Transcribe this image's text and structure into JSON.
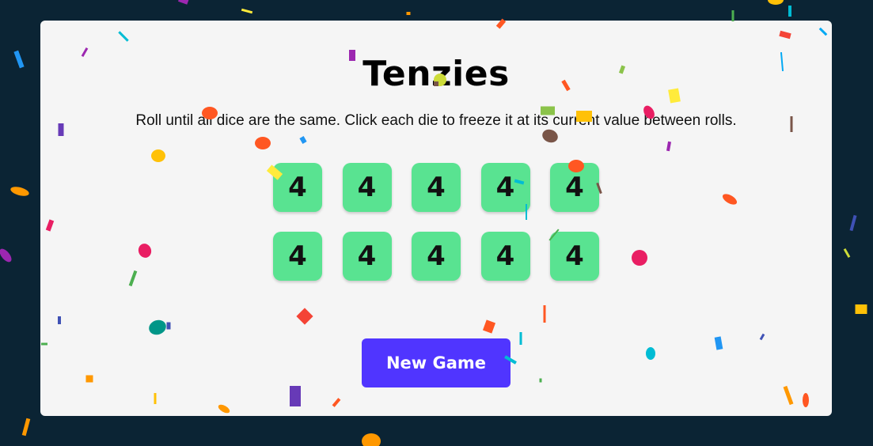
{
  "game": {
    "title": "Tenzies",
    "instructions": "Roll until all dice are the same. Click each die to freeze it at its current value between rolls.",
    "dice": [
      "4",
      "4",
      "4",
      "4",
      "4",
      "4",
      "4",
      "4",
      "4",
      "4"
    ],
    "new_game_label": "New Game",
    "won": true
  },
  "colors": {
    "background": "#0b2434",
    "board": "#f5f5f5",
    "die": "#59e391",
    "button": "#5035ff",
    "confetti": [
      "#f44336",
      "#e91e63",
      "#9c27b0",
      "#673ab7",
      "#3f51b5",
      "#2196f3",
      "#03a9f4",
      "#00bcd4",
      "#009688",
      "#4caf50",
      "#8bc34a",
      "#cddc39",
      "#ffeb3b",
      "#ffc107",
      "#ff9800",
      "#ff5722",
      "#795548"
    ]
  }
}
